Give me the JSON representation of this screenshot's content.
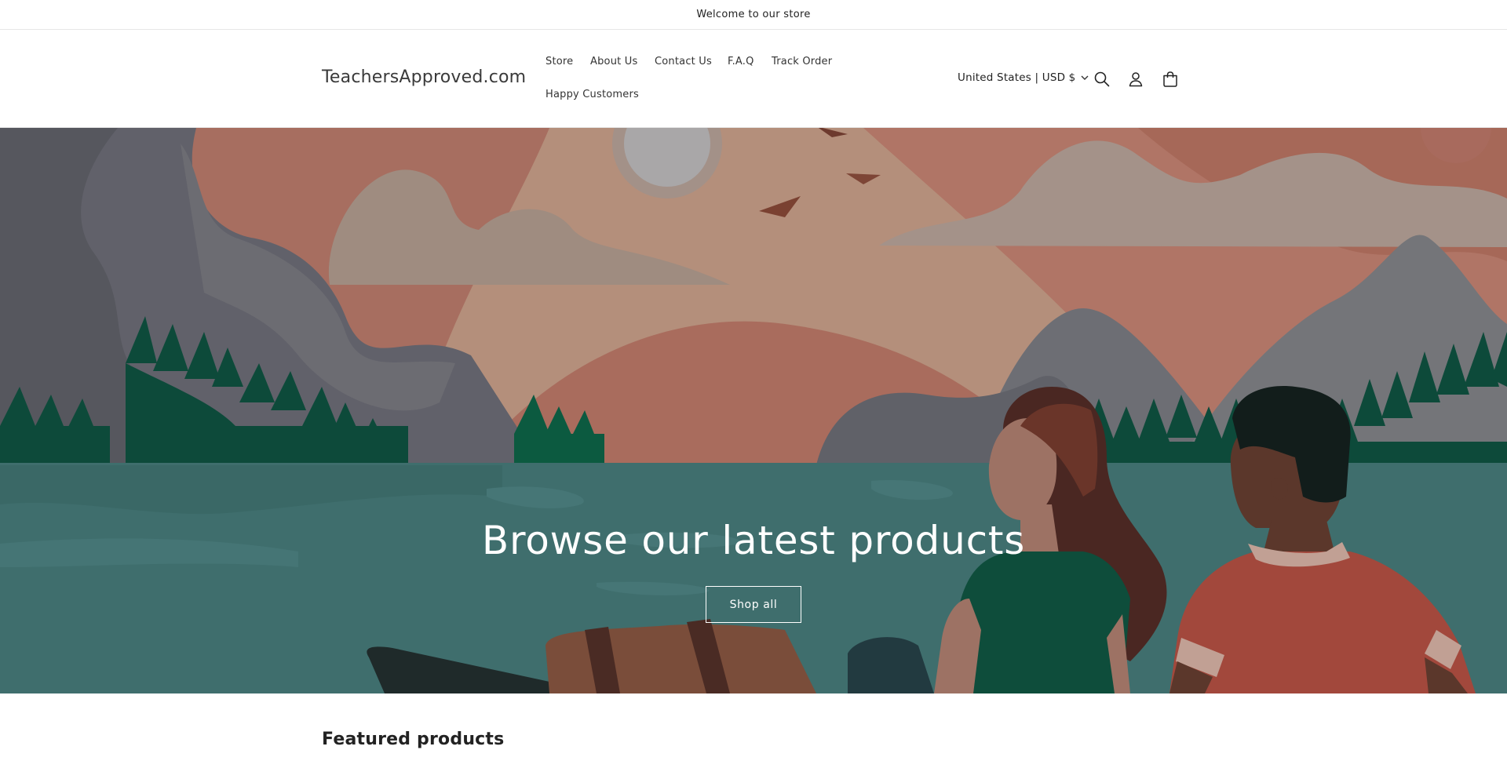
{
  "announcement": {
    "text": "Welcome to our store"
  },
  "header": {
    "logo": "TeachersApproved.com",
    "nav": [
      {
        "label": "Store"
      },
      {
        "label": "About Us"
      },
      {
        "label": "Contact Us"
      },
      {
        "label": "F.A.Q"
      },
      {
        "label": "Track Order"
      },
      {
        "label": "Happy Customers"
      }
    ],
    "country_selector": "United States | USD $",
    "icons": [
      "search-icon",
      "account-icon",
      "cart-icon"
    ]
  },
  "hero": {
    "title": "Browse our latest products",
    "button_label": "Shop all"
  },
  "featured": {
    "title": "Featured products"
  },
  "colors": {
    "hero_water": "#3f6e6d",
    "hero_sky": "#b48f7b",
    "mountain": "#6a6b6e",
    "tree": "#0d4a3a",
    "accent_red": "#a2483c"
  }
}
